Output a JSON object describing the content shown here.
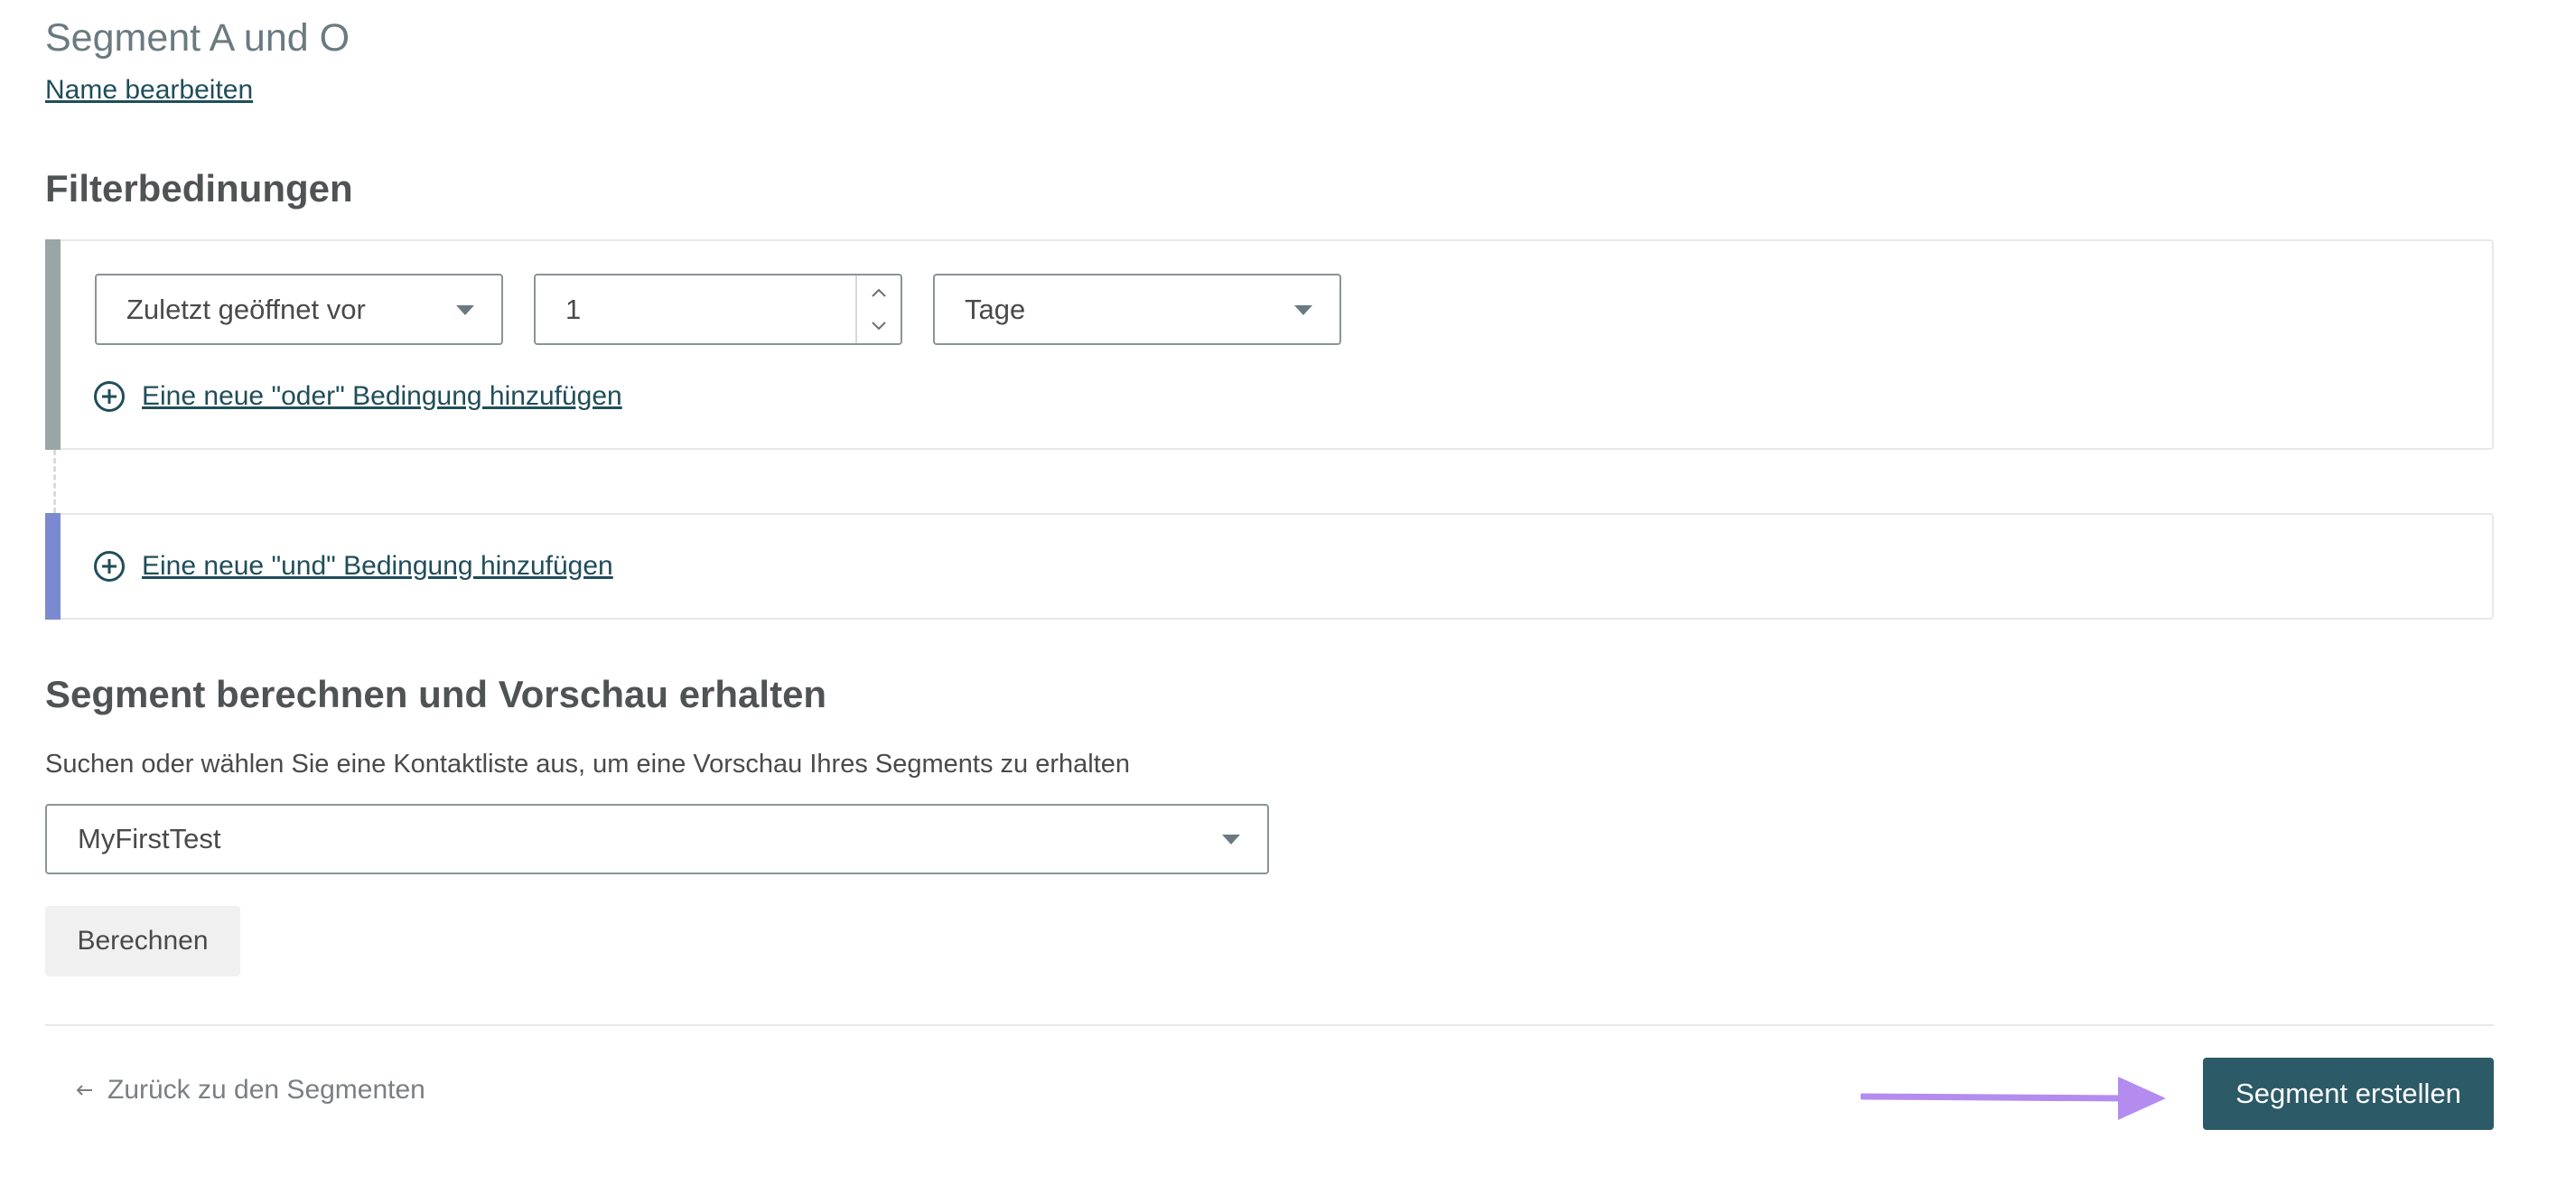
{
  "segment": {
    "name": "Segment A und O",
    "edit_name_label": "Name bearbeiten"
  },
  "filter": {
    "heading": "Filterbedinungen",
    "condition": {
      "field": "Zuletzt geöffnet vor",
      "value": "1",
      "unit": "Tage"
    },
    "add_or_label": "Eine neue \"oder\" Bedingung hinzufügen",
    "add_and_label": "Eine neue \"und\" Bedingung hinzufügen"
  },
  "preview": {
    "heading": "Segment berechnen und Vorschau erhalten",
    "description": "Suchen oder wählen Sie eine Kontaktliste aus, um eine Vorschau Ihres Segments zu erhalten",
    "selected_list": "MyFirstTest",
    "calculate_label": "Berechnen"
  },
  "footer": {
    "back_label": "Zurück zu den Segmenten",
    "create_label": "Segment erstellen"
  },
  "icons": {
    "caret": "chevron-down-icon",
    "plus": "plus-circle-icon",
    "back": "arrow-left-icon",
    "annotation": "arrow-right-icon"
  },
  "colors": {
    "primary": "#2c5a66",
    "link": "#1f4e5a",
    "or_bar": "#98a6a6",
    "and_bar": "#7b8ad0",
    "annotation_arrow": "#b48cf0"
  }
}
